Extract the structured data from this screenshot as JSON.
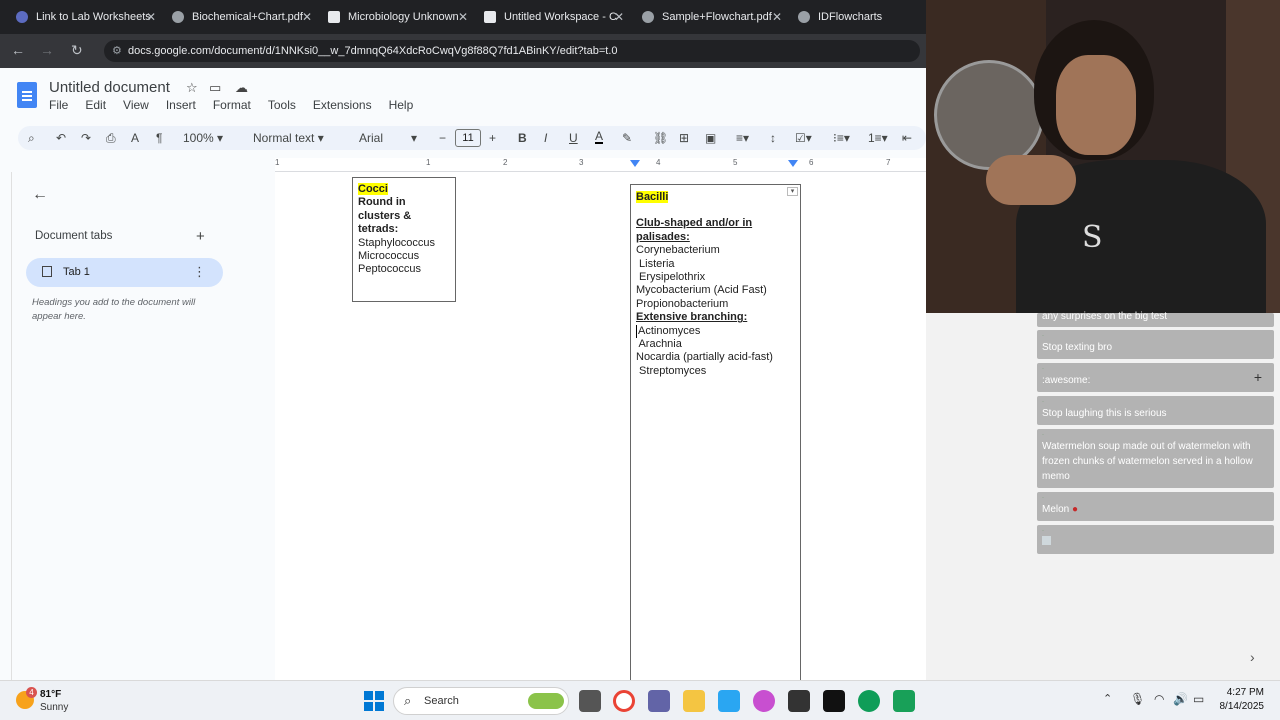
{
  "browser": {
    "tabs": [
      {
        "title": "Link to Lab Worksheets",
        "favicon_color": "#5c6bc0"
      },
      {
        "title": "Biochemical+Chart.pdf",
        "favicon_color": "#9aa0a6"
      },
      {
        "title": "Microbiology Unknown",
        "favicon_color": "#e8eaed"
      },
      {
        "title": "Untitled Workspace - C",
        "favicon_color": "#e8eaed"
      },
      {
        "title": "Sample+Flowchart.pdf",
        "favicon_color": "#9aa0a6"
      },
      {
        "title": "IDFlowcharts",
        "favicon_color": "#9aa0a6"
      }
    ],
    "url": "docs.google.com/document/d/1NNKsi0__w_7dmnqQ64XdcRoCwqVg8f88Q7fd1ABinKY/edit?tab=t.0"
  },
  "docs": {
    "title": "Untitled document",
    "menu": [
      "File",
      "Edit",
      "View",
      "Insert",
      "Format",
      "Tools",
      "Extensions",
      "Help"
    ],
    "toolbar": {
      "zoom": "100%",
      "style": "Normal text",
      "font": "Arial",
      "font_size": "11"
    },
    "ruler_numbers": [
      "1",
      "1",
      "2",
      "3",
      "4",
      "5",
      "6",
      "7"
    ],
    "sidebar": {
      "tabs_label": "Document tabs",
      "tab1_label": "Tab 1",
      "headings_hint": "Headings you add to the document will appear here."
    },
    "cocci": {
      "heading": "Cocci",
      "subheading_lines": [
        "Round in",
        "clusters &",
        "tetrads:"
      ],
      "items": [
        "Staphylococcus",
        "Micrococcus",
        "Peptococcus"
      ]
    },
    "bacilli": {
      "heading": "Bacilli",
      "section1_lines": [
        "Club-shaped and/or in",
        "palisades:"
      ],
      "section1_items": [
        "Corynebacterium",
        " Listeria",
        " Erysipelothrix",
        "Mycobacterium (Acid Fast)",
        "Propionobacterium"
      ],
      "section2": "Extensive branching:",
      "section2_items": [
        "Actinomyces",
        " Arachnia",
        "Nocardia (partially acid-fast)",
        " Streptomyces"
      ]
    }
  },
  "chat": {
    "messages": [
      {
        "text": "any surprises on the big test"
      },
      {
        "text": "Stop texting bro"
      },
      {
        "text": ":awesome:"
      },
      {
        "text": "Stop laughing this is serious"
      },
      {
        "text": "Watermelon soup made out of watermelon with frozen chunks of watermelon served in a hollow memo"
      },
      {
        "text": "Melon"
      },
      {
        "text": ""
      }
    ]
  },
  "taskbar": {
    "weather_temp": "81°F",
    "weather_desc": "Sunny",
    "weather_badge": "4",
    "search_label": "Search",
    "time": "4:27 PM",
    "date": "8/14/2025"
  }
}
